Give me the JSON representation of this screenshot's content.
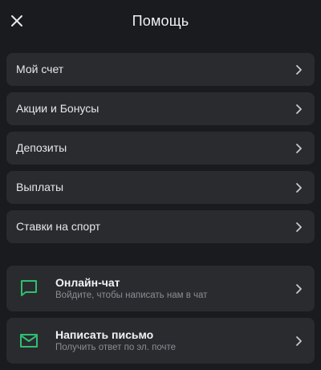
{
  "header": {
    "title": "Помощь",
    "close_icon": "close-icon"
  },
  "menu": {
    "items": [
      {
        "label": "Мой счет"
      },
      {
        "label": "Акции и Бонусы"
      },
      {
        "label": "Депозиты"
      },
      {
        "label": "Выплаты"
      },
      {
        "label": "Ставки на спорт"
      }
    ]
  },
  "contacts": {
    "items": [
      {
        "title": "Онлайн-чат",
        "subtitle": "Войдите, чтобы написать нам в чат",
        "icon": "chat-icon"
      },
      {
        "title": "Написать письмо",
        "subtitle": "Получить ответ по эл. почте",
        "icon": "mail-icon"
      }
    ]
  },
  "colors": {
    "background": "#1a1b1e",
    "card": "#2a2b2f",
    "accent": "#2fbf71",
    "muted_text": "#8b8d93"
  }
}
